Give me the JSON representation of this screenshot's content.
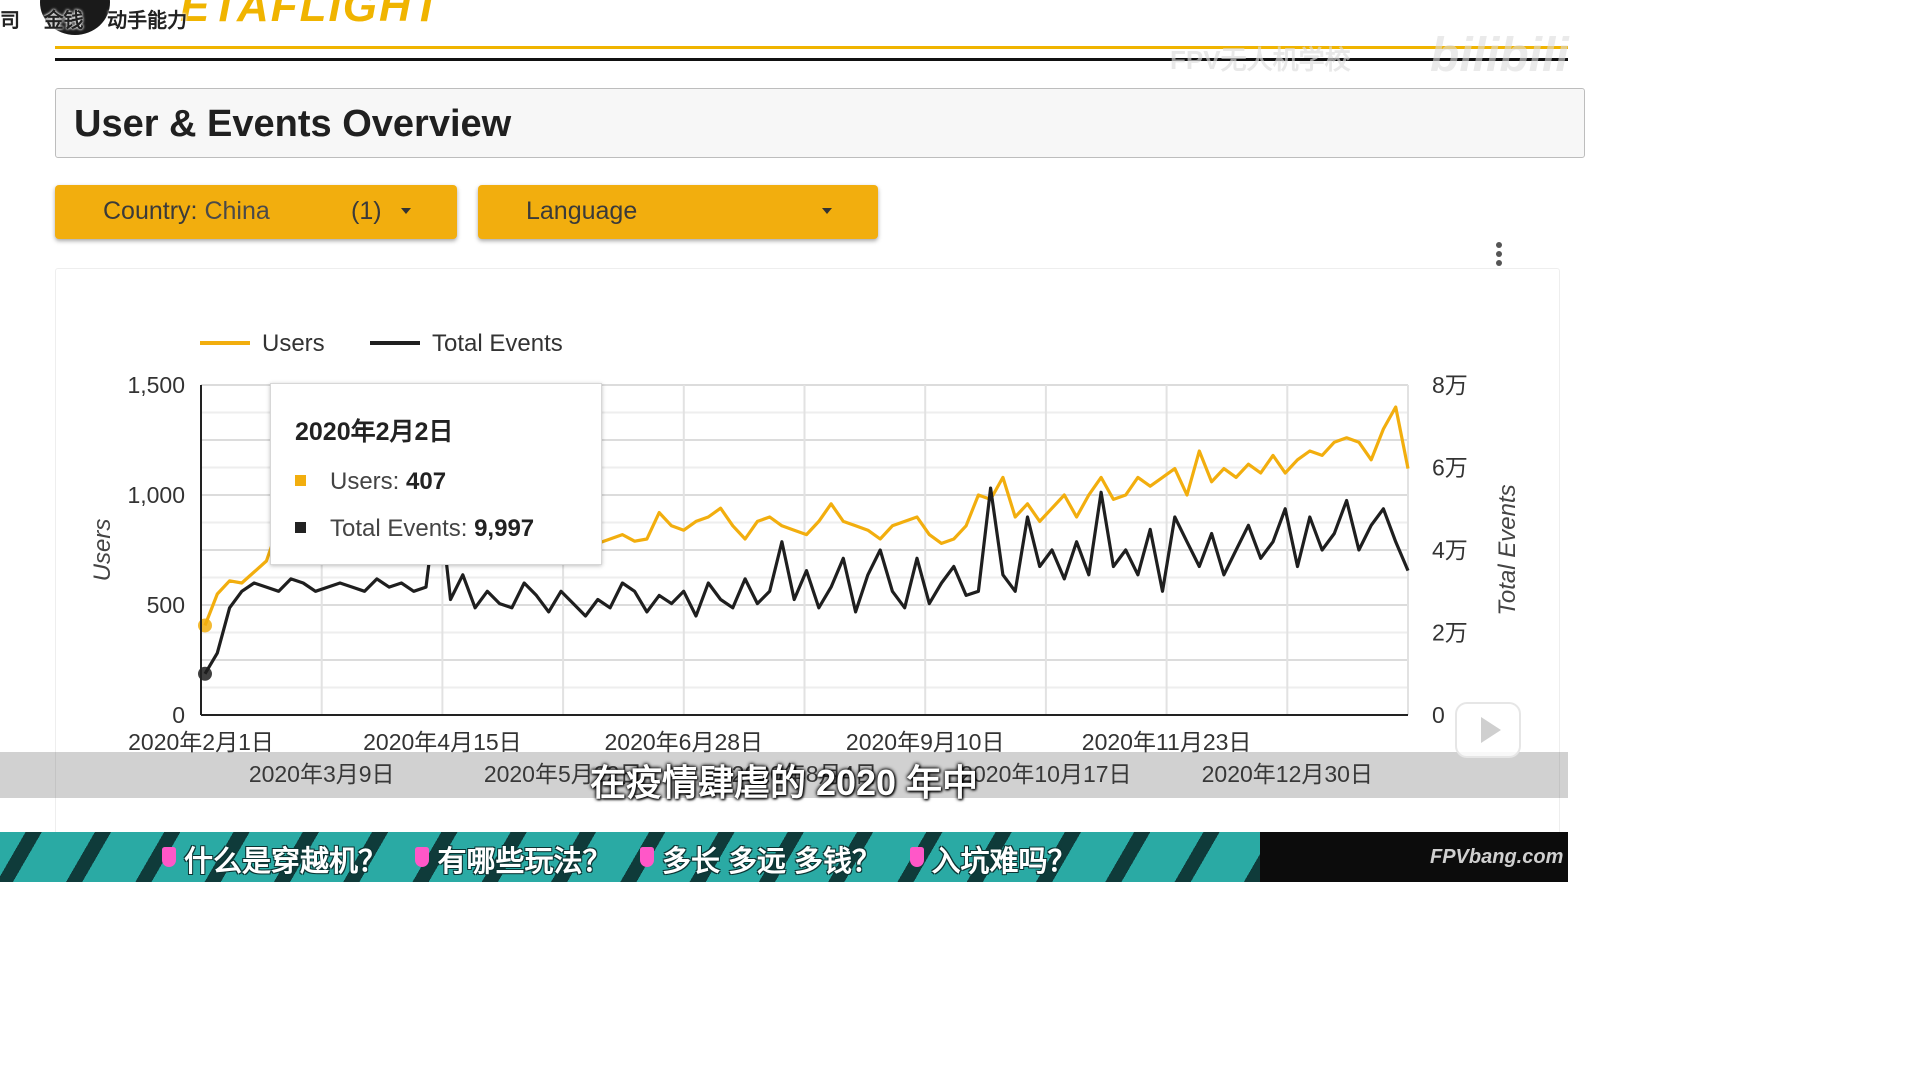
{
  "header": {
    "logo_text": "ETAFLIGHT",
    "tags": [
      "司",
      "金钱",
      "动手能力"
    ],
    "watermark": "FPV无人机学校",
    "watermark_brand": "bilibili"
  },
  "title": "User & Events Overview",
  "filters": {
    "country": {
      "label": "Country",
      "value": "China",
      "count": "(1)"
    },
    "language": {
      "label": "Language"
    }
  },
  "tooltip": {
    "date": "2020年2月2日",
    "users_label": "Users",
    "users_value": "407",
    "events_label": "Total Events",
    "events_value": "9,997"
  },
  "subtitle": "在疫情肆虐的 2020 年中",
  "banner": {
    "questions": [
      "什么是穿越机？",
      "有哪些玩法？",
      "多长  多远  多钱？",
      "入坑难吗？"
    ],
    "brand": "FPVbang.com"
  },
  "colors": {
    "users": "#f2ae0e",
    "events": "#1f1f1f"
  },
  "chart_data": {
    "type": "line",
    "y_left": {
      "label": "Users",
      "range": [
        0,
        1500
      ],
      "ticks": [
        "0",
        "500",
        "1,000",
        "1,500"
      ]
    },
    "y_right": {
      "label": "Total Events",
      "range": [
        0,
        80000
      ],
      "ticks": [
        "0",
        "2万",
        "4万",
        "6万",
        "8万"
      ]
    },
    "x_ticks_top": [
      "2020年2月1日",
      "2020年4月15日",
      "2020年6月28日",
      "2020年9月10日",
      "2020年11月23日"
    ],
    "x_ticks_bottom": [
      "2020年3月9日",
      "2020年5月22日",
      "2020年8月4日",
      "2020年10月17日",
      "2020年12月30日"
    ],
    "grid": true,
    "legend": "top-left",
    "series": [
      {
        "name": "Users",
        "axis": "left",
        "values": [
          407,
          550,
          610,
          600,
          650,
          700,
          860,
          760,
          760,
          780,
          800,
          790,
          830,
          810,
          800,
          860,
          840,
          800,
          860,
          840,
          800,
          780,
          800,
          820,
          780,
          800,
          760,
          780,
          820,
          800,
          810,
          760,
          780,
          800,
          820,
          790,
          800,
          920,
          860,
          840,
          880,
          900,
          940,
          860,
          800,
          880,
          900,
          860,
          840,
          820,
          880,
          960,
          880,
          860,
          840,
          800,
          860,
          880,
          900,
          820,
          780,
          800,
          860,
          1000,
          980,
          1080,
          900,
          960,
          880,
          940,
          1000,
          900,
          1000,
          1080,
          980,
          1000,
          1080,
          1040,
          1080,
          1120,
          1000,
          1200,
          1060,
          1120,
          1080,
          1140,
          1100,
          1180,
          1100,
          1160,
          1200,
          1180,
          1240,
          1260,
          1240,
          1160,
          1300,
          1400,
          1120
        ]
      },
      {
        "name": "Total Events",
        "axis": "right",
        "values": [
          9997,
          15000,
          26000,
          30000,
          32000,
          31000,
          30000,
          33000,
          32000,
          30000,
          31000,
          32000,
          31000,
          30000,
          33000,
          31000,
          32000,
          30000,
          31000,
          55000,
          28000,
          34000,
          26000,
          30000,
          27000,
          26000,
          32000,
          29000,
          25000,
          30000,
          27000,
          24000,
          28000,
          26000,
          32000,
          30000,
          25000,
          29000,
          27000,
          30000,
          24000,
          32000,
          28000,
          26000,
          33000,
          27000,
          30000,
          42000,
          28000,
          35000,
          26000,
          31000,
          38000,
          25000,
          34000,
          40000,
          30000,
          26000,
          38000,
          27000,
          32000,
          36000,
          29000,
          30000,
          55000,
          34000,
          30000,
          48000,
          36000,
          40000,
          33000,
          42000,
          34000,
          54000,
          36000,
          40000,
          34000,
          45000,
          30000,
          48000,
          42000,
          36000,
          44000,
          34000,
          40000,
          46000,
          38000,
          42000,
          50000,
          36000,
          48000,
          40000,
          44000,
          52000,
          40000,
          46000,
          50000,
          42000,
          35000
        ]
      }
    ]
  }
}
